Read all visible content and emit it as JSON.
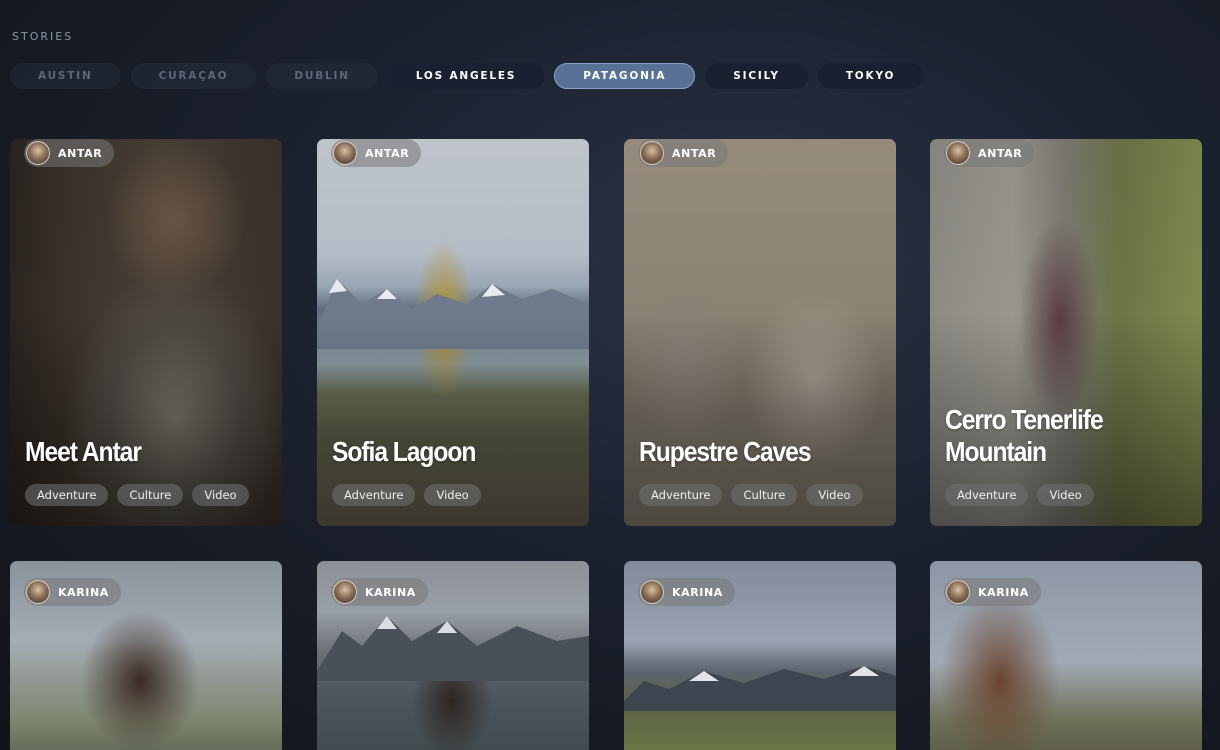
{
  "section_label": "STORIES",
  "tabs": [
    {
      "label": "AUSTIN",
      "state": "dim"
    },
    {
      "label": "CURAÇAO",
      "state": "dim"
    },
    {
      "label": "DUBLIN",
      "state": "dim"
    },
    {
      "label": "LOS ANGELES",
      "state": "normal"
    },
    {
      "label": "PATAGONIA",
      "state": "active"
    },
    {
      "label": "SICILY",
      "state": "normal"
    },
    {
      "label": "TOKYO",
      "state": "normal"
    }
  ],
  "cards": [
    {
      "author": "ANTAR",
      "title": "Meet Antar",
      "tags": [
        "Adventure",
        "Culture",
        "Video"
      ]
    },
    {
      "author": "ANTAR",
      "title": "Sofia Lagoon",
      "tags": [
        "Adventure",
        "Video"
      ]
    },
    {
      "author": "ANTAR",
      "title": "Rupestre Caves",
      "tags": [
        "Adventure",
        "Culture",
        "Video"
      ]
    },
    {
      "author": "ANTAR",
      "title": "Cerro Tenerlife Mountain",
      "tags": [
        "Adventure",
        "Video"
      ]
    },
    {
      "author": "KARINA"
    },
    {
      "author": "KARINA"
    },
    {
      "author": "KARINA"
    },
    {
      "author": "KARINA"
    }
  ],
  "colors": {
    "active_tab": "#5a7196",
    "tab_background": "#1a2030",
    "page_background": "#1c2230"
  }
}
